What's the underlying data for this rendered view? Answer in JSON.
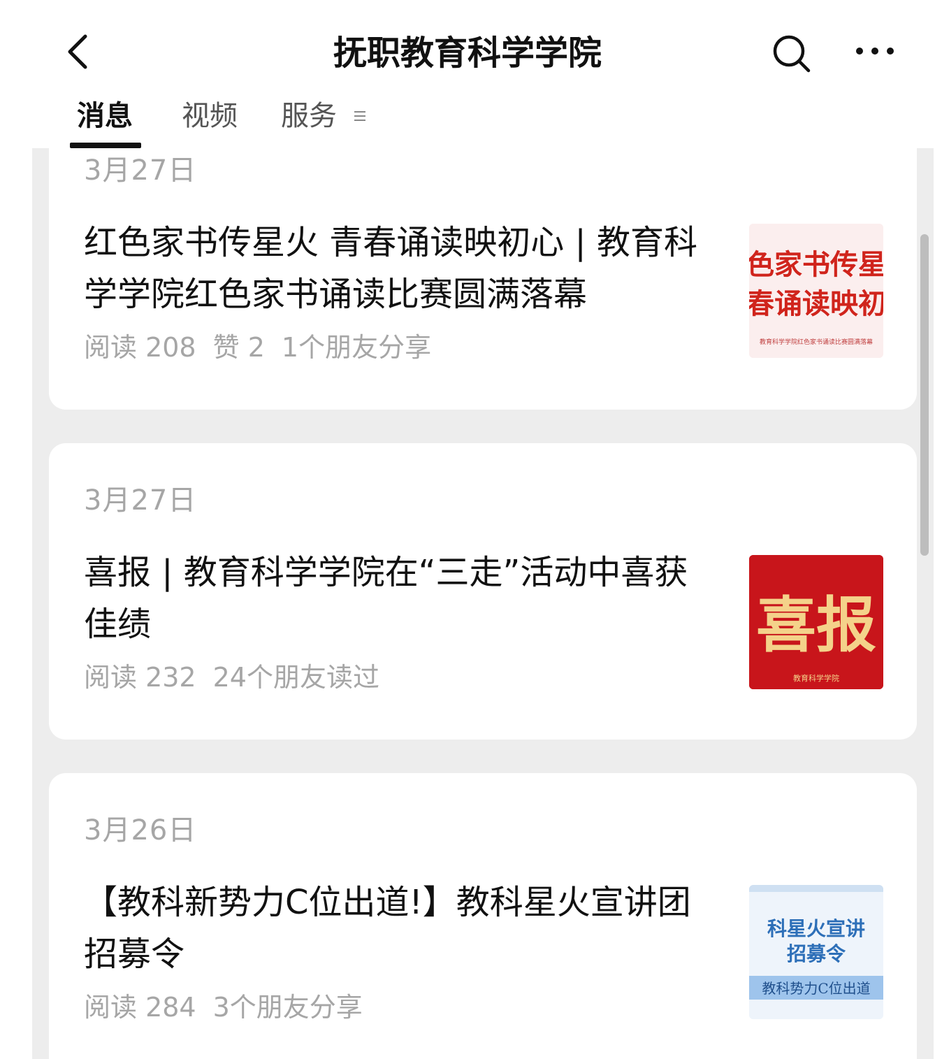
{
  "header": {
    "title": "抚职教育科学学院",
    "back_icon": "chevron-left-icon",
    "search_icon": "search-icon",
    "more_icon": "more-horizontal-icon"
  },
  "tabs": [
    {
      "label": "消息",
      "active": true
    },
    {
      "label": "视频",
      "active": false
    },
    {
      "label": "服务",
      "active": false
    }
  ],
  "tab_menu_icon": "menu-lines-icon",
  "articles": [
    {
      "date": "3月27日",
      "title_line1": "红色家书传星火 青春诵读映初心 | 教育科",
      "title_line2": "学学院红色家书诵读比赛圆满落幕",
      "reads": "阅读 208",
      "likes": "赞 2",
      "social": "1个朋友分享",
      "thumb": {
        "line1": "色家书传星",
        "line2": "春诵读映初",
        "caption": "教育科学学院红色家书诵读比赛圆满落幕",
        "color": "#d0241c"
      }
    },
    {
      "date": "3月27日",
      "title_line1": "喜报 | 教育科学学院在“三走”活动中喜获",
      "title_line2": "佳绩",
      "reads": "阅读 232",
      "social": "24个朋友读过",
      "thumb": {
        "big": "喜报",
        "caption": "教育科学学院",
        "color": "#c8151b",
        "text_color": "#f4d28a"
      }
    },
    {
      "date": "3月26日",
      "title_line1": "【教科新势力C位出道!】教科星火宣讲团",
      "title_line2": "招募令",
      "reads": "阅读 284",
      "social": "3个朋友分享",
      "thumb": {
        "line1": "科星火宣讲",
        "line2": "招募令",
        "banner": "教科势力C位出道",
        "color": "#2d6fb8"
      }
    }
  ]
}
